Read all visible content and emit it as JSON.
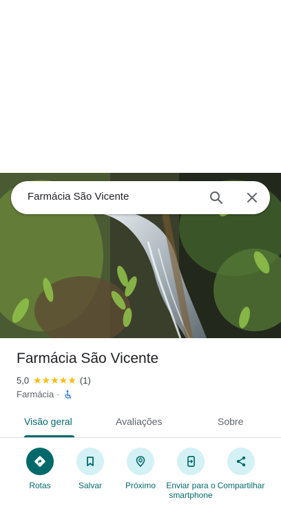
{
  "search": {
    "query": "Farmácia São Vicente"
  },
  "place": {
    "title": "Farmácia São Vicente",
    "rating_value": "5,0",
    "stars": 5,
    "review_count": "(1)",
    "category": "Farmácia",
    "separator": "·",
    "accessibility_icon": "wheelchair-icon"
  },
  "tabs": [
    {
      "label": "Visão geral",
      "active": true
    },
    {
      "label": "Avaliações",
      "active": false
    },
    {
      "label": "Sobre",
      "active": false
    }
  ],
  "actions": [
    {
      "label": "Rotas",
      "icon": "directions-icon"
    },
    {
      "label": "Salvar",
      "icon": "bookmark-icon"
    },
    {
      "label": "Próximo",
      "icon": "nearby-icon"
    },
    {
      "label": "Enviar para o smartphone",
      "icon": "send-to-phone-icon"
    },
    {
      "label": "Compartilhar",
      "icon": "share-icon"
    }
  ],
  "colors": {
    "accent": "#01696a",
    "action_bg": "#d4f1f5",
    "star": "#fbbc04"
  }
}
